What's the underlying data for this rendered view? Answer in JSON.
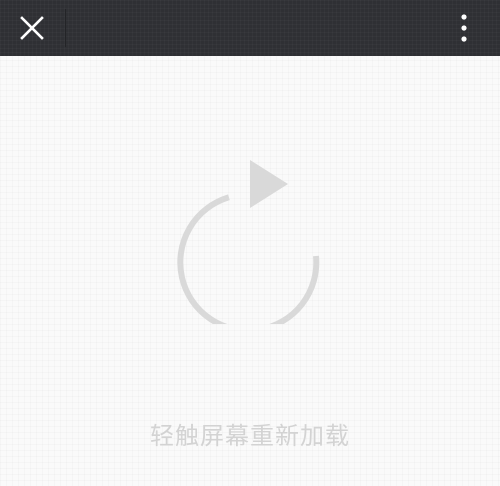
{
  "topbar": {
    "close_icon": "close-icon",
    "more_icon": "more-vertical-icon",
    "background_color": "#2f3034",
    "icon_color": "#ffffff"
  },
  "content": {
    "reload_icon": "refresh-icon",
    "reload_text": "轻触屏幕重新加载",
    "icon_color": "#d9d9d9",
    "text_color": "#d3d3d3"
  }
}
